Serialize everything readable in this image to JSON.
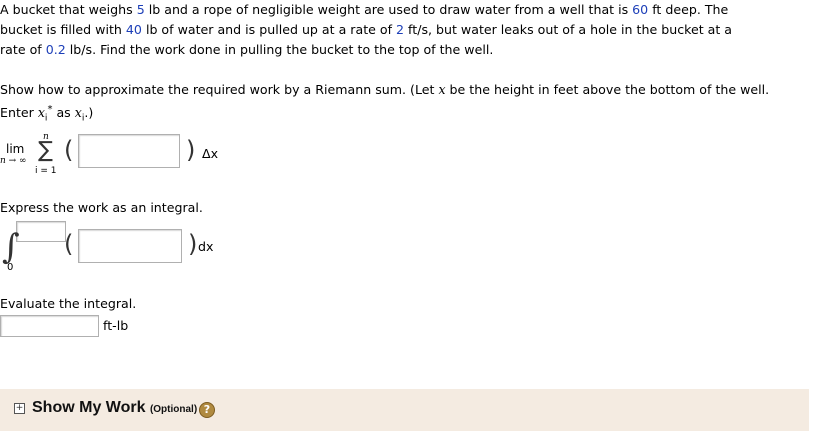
{
  "problem": {
    "p1a": "A bucket that weighs ",
    "bucket_weight": "5",
    "p1b": " lb and a rope of negligible weight are used to draw water from a well that is ",
    "well_depth": "60",
    "p1c": " ft deep. The",
    "p2a": "bucket is filled with ",
    "water_weight": "40",
    "p2b": " lb of water and is pulled up at a rate of ",
    "pull_rate": "2",
    "p2c": " ft/s, but water leaks out of a hole in the bucket at a",
    "p3a": "rate of ",
    "leak_rate": "0.2",
    "p3b": " lb/s. Find the work done in pulling the bucket to the top of the well."
  },
  "instructions": {
    "i1a": "Show how to approximate the required work by a Riemann sum. (Let ",
    "i1var": "x",
    "i1b": " be the height in feet above the bottom of the well.",
    "i2a": "Enter ",
    "i2x": "x",
    "i2sub": "i",
    "i2star": "*",
    "i2as": " as ",
    "i2x2": "x",
    "i2sub2": "i",
    "i2end": ".)"
  },
  "riemann": {
    "lim": "lim",
    "lim_sub": "n → ∞",
    "upper": "n",
    "lower": "i = 1",
    "sigma": "∑",
    "open": "(",
    "close": ")",
    "dx": "Δx"
  },
  "integral_section": {
    "label": "Express the work as an integral.",
    "integral_sign": "∫",
    "lower": "0",
    "open": "(",
    "close": ")",
    "dx": "dx"
  },
  "evaluate_section": {
    "label": "Evaluate the integral.",
    "unit": "ft-lb"
  },
  "footer": {
    "expand": "+",
    "show_my_work": "Show My Work",
    "optional": "(Optional)",
    "help": "?"
  }
}
